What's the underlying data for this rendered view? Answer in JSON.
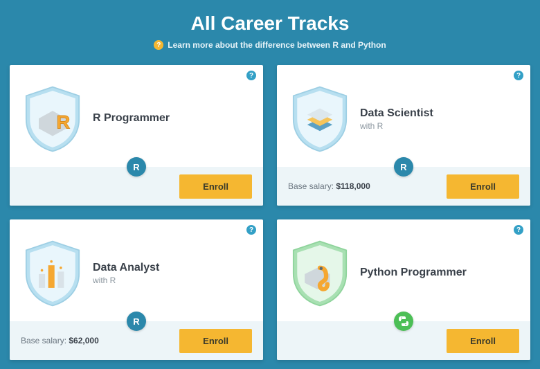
{
  "header": {
    "title": "All Career Tracks",
    "subtitle": "Learn more about the difference between R and Python"
  },
  "labels": {
    "enroll": "Enroll",
    "salary_prefix": "Base salary: ",
    "help_glyph": "?"
  },
  "lang_badges": {
    "r": "R",
    "py_icon": "python-icon"
  },
  "tracks": [
    {
      "title": "R Programmer",
      "subtitle": "",
      "lang": "r",
      "salary": "",
      "icon": "r-letter"
    },
    {
      "title": "Data Scientist",
      "subtitle": "with R",
      "lang": "r",
      "salary": "$118,000",
      "icon": "stack"
    },
    {
      "title": "Data Analyst",
      "subtitle": "with R",
      "lang": "r",
      "salary": "$62,000",
      "icon": "bars"
    },
    {
      "title": "Python Programmer",
      "subtitle": "",
      "lang": "py",
      "salary": "",
      "icon": "python"
    }
  ]
}
